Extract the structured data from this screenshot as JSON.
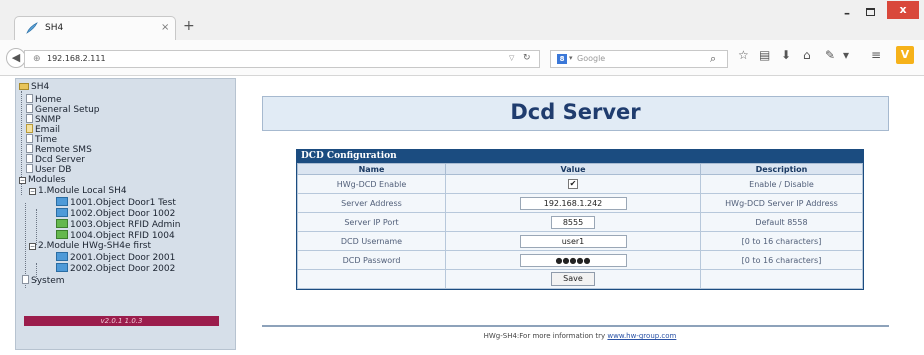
{
  "browser": {
    "tab_title": "SH4",
    "tab_close": "×",
    "new_tab": "+",
    "url": "192.168.2.111",
    "search_placeholder": "Google",
    "window_controls": {
      "minimize": "–",
      "close": "x"
    },
    "toolbar_icons": [
      "search-go-icon",
      "bookmark-star-icon",
      "reading-list-icon",
      "download-icon",
      "home-icon",
      "tools-icon",
      "menu-icon",
      "extension-icon"
    ]
  },
  "tree": {
    "root": "SH4",
    "items": [
      "Home",
      "General Setup",
      "SNMP",
      "Email",
      "Time",
      "Remote SMS",
      "Dcd Server",
      "User DB"
    ],
    "modules_label": "Modules",
    "modules": [
      {
        "label": "1.Module Local SH4",
        "children": [
          "1001.Object Door1 Test",
          "1002.Object Door 1002",
          "1003.Object RFID Admin",
          "1004.Object RFID 1004"
        ]
      },
      {
        "label": "2.Module HWg-SH4e first",
        "children": [
          "2001.Object Door 2001",
          "2002.Object Door 2002"
        ]
      }
    ],
    "system": "System",
    "version": "v2.0.1 1.0.3"
  },
  "page": {
    "title": "Dcd Server",
    "section_title": "DCD Configuration",
    "columns": [
      "Name",
      "Value",
      "Description"
    ],
    "rows": [
      {
        "name": "HWg-DCD Enable",
        "value": "✔",
        "description": "Enable / Disable"
      },
      {
        "name": "Server Address",
        "value": "192.168.1.242",
        "description": "HWg-DCD Server IP Address"
      },
      {
        "name": "Server IP Port",
        "value": "8555",
        "description": "Default 8558"
      },
      {
        "name": "DCD Username",
        "value": "user1",
        "description": "[0 to 16 characters]"
      },
      {
        "name": "DCD Password",
        "value": "●●●●●",
        "description": "[0 to 16 characters]"
      }
    ],
    "save_label": "Save",
    "footer_text": "HWg-SH4:For more information try ",
    "footer_link": "www.hw-group.com"
  },
  "colors": {
    "header_blue": "#1b4c80",
    "tree_bg": "#d6dfe9",
    "version_bar": "#9b1d4c",
    "close_red": "#d9483b"
  }
}
